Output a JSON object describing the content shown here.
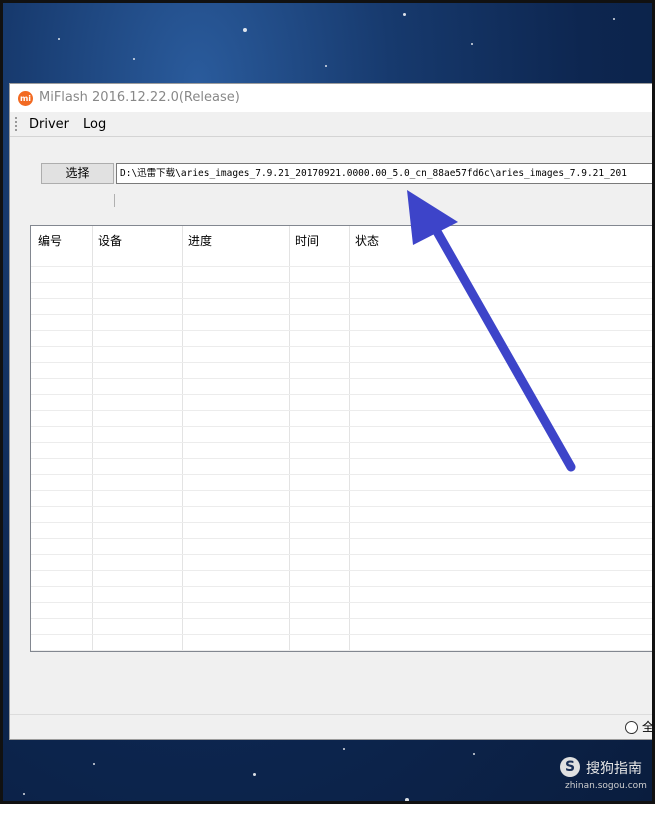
{
  "window": {
    "title": "MiFlash 2016.12.22.0(Release)",
    "icon_text": "mi"
  },
  "menu": {
    "items": [
      "Driver",
      "Log"
    ]
  },
  "toolbar": {
    "select_label": "选择",
    "path_value": "D:\\迅雷下载\\aries_images_7.9.21_20170921.0000.00_5.0_cn_88ae57fd6c\\aries_images_7.9.21_201"
  },
  "table": {
    "columns": [
      "编号",
      "设备",
      "进度",
      "时间",
      "状态"
    ]
  },
  "footer": {
    "radio_label": "全"
  },
  "watermark": {
    "icon": "S",
    "text": "搜狗指南",
    "url": "zhinan.sogou.com"
  },
  "colors": {
    "arrow": "#3d44c9",
    "app_icon": "#f26a22"
  }
}
